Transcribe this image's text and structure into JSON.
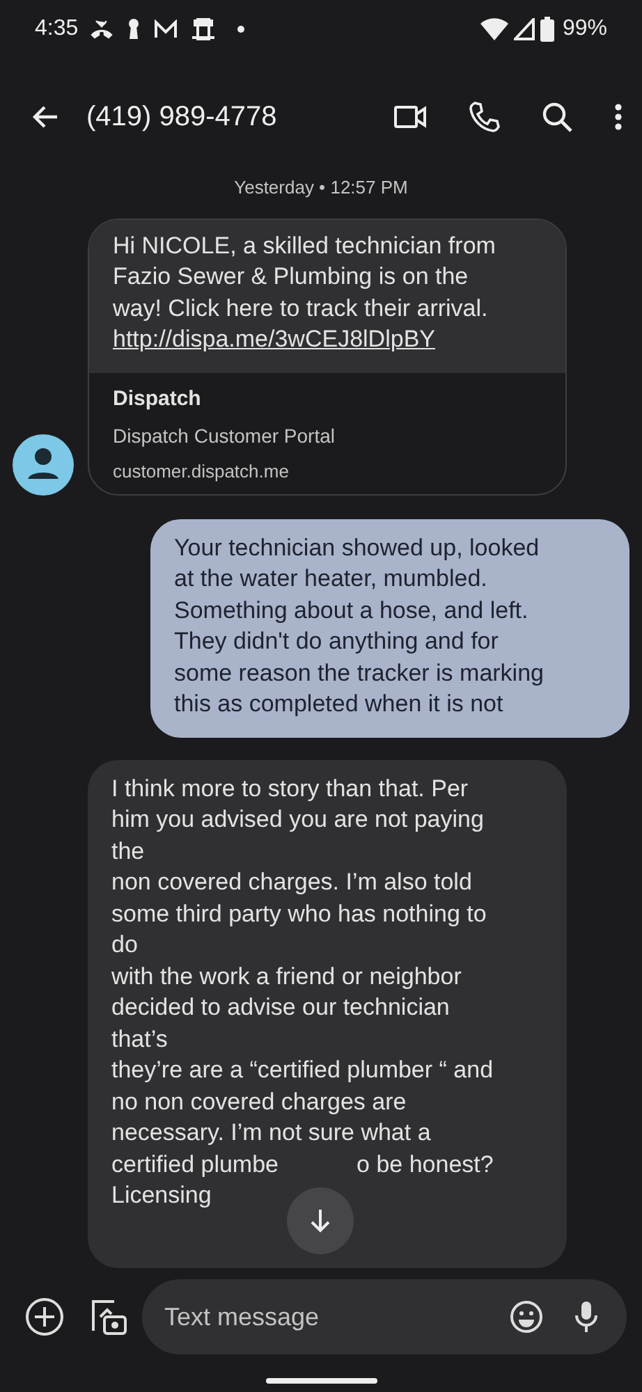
{
  "status_bar": {
    "time": "4:35",
    "battery": "99%"
  },
  "header": {
    "title": "(419) 989-4778"
  },
  "date_divider": "Yesterday • 12:57 PM",
  "messages": [
    {
      "kind": "received_link",
      "text": "Hi NICOLE, a skilled technician from Fazio Sewer & Plumbing is on the way! Click here to track their arrival.",
      "link": "http://dispa.me/3wCEJ8lDlpBY",
      "preview": {
        "title": "Dispatch",
        "description": "Dispatch Customer Portal",
        "domain": "customer.dispatch.me"
      }
    },
    {
      "kind": "sent",
      "lines": [
        "Your technician showed up, looked",
        "at the water heater, mumbled.",
        "Something about a hose, and left.",
        "They didn't do anything and for",
        "some reason the tracker is marking",
        "this as completed when it is not"
      ]
    },
    {
      "kind": "received",
      "lines": [
        "I think more to story than that. Per",
        "him you advised you are not paying",
        "the",
        "non covered charges. I’m also told",
        "some third party who has nothing to",
        "do",
        "with the work a friend or neighbor",
        "decided to advise our technician",
        "that’s",
        "they’re are a “certified plumber “ and",
        "no non covered charges are",
        "necessary. I’m not sure what a",
        [
          "certified plumbe",
          "o be honest?"
        ],
        "Licensing"
      ]
    }
  ],
  "composer": {
    "placeholder": "Text message"
  }
}
